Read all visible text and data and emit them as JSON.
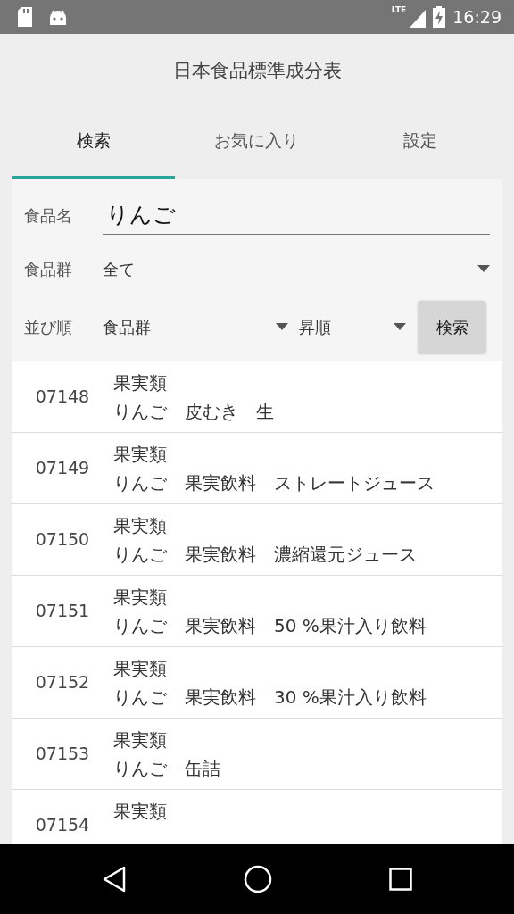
{
  "status_bar": {
    "network_type": "LTE",
    "time": "16:29"
  },
  "app_title": "日本食品標準成分表",
  "tabs": [
    {
      "label": "検索",
      "selected": true
    },
    {
      "label": "お気に入り",
      "selected": false
    },
    {
      "label": "設定",
      "selected": false
    }
  ],
  "search_form": {
    "name_label": "食品名",
    "name_value": "りんご",
    "group_label": "食品群",
    "group_value": "全て",
    "sort_label": "並び順",
    "sort_field": "食品群",
    "sort_order": "昇順",
    "search_button": "検索"
  },
  "results": [
    {
      "code": "07148",
      "group": "果実類",
      "name": "りんご　皮むき　生"
    },
    {
      "code": "07149",
      "group": "果実類",
      "name": "りんご　果実飲料　ストレートジュース"
    },
    {
      "code": "07150",
      "group": "果実類",
      "name": "りんご　果実飲料　濃縮還元ジュース"
    },
    {
      "code": "07151",
      "group": "果実類",
      "name": "りんご　果実飲料　50 %果汁入り飲料"
    },
    {
      "code": "07152",
      "group": "果実類",
      "name": "りんご　果実飲料　30 %果汁入り飲料"
    },
    {
      "code": "07153",
      "group": "果実類",
      "name": "りんご　缶詰"
    },
    {
      "code": "07154",
      "group": "果実類"
    }
  ]
}
